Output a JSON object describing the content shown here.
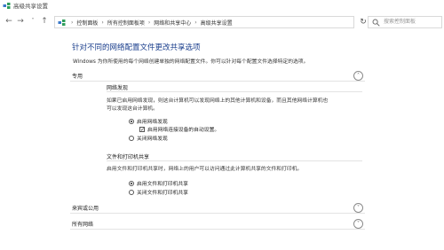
{
  "window": {
    "title": "高级共享设置"
  },
  "address": {
    "breadcrumbs": [
      "控制面板",
      "所有控制面板项",
      "网络和共享中心",
      "高级共享设置"
    ]
  },
  "search": {
    "placeholder": "搜索控制面板"
  },
  "main": {
    "heading": "针对不同的网络配置文件更改共享选项",
    "description": "Windows 为你所使用的每个网络创建单独的网络配置文件。你可以针对每个配置文件选择特定的选项。",
    "profiles": {
      "private": {
        "label": "专用",
        "network_discovery": {
          "title": "网络发现",
          "text_line1": "如果已启用网络发现，则这台计算机可以发现网络上的其他计算机和设备，而且其他网络计算机也",
          "text_line2": "可以发现这台计算机。",
          "option_on": "启用网络发现",
          "option_auto": "启用网络连接设备的自动设置。",
          "option_off": "关闭网络发现",
          "selected": "on",
          "auto_checked": true
        },
        "file_printer_sharing": {
          "title": "文件和打印机共享",
          "text": "启用文件和打印机共享时，网络上的用户可以访问通过此计算机共享的文件和打印机。",
          "option_on": "启用文件和打印机共享",
          "option_off": "关闭文件和打印机共享",
          "selected": "on"
        }
      },
      "guest_public": {
        "label": "来宾或公用"
      },
      "all_networks": {
        "label": "所有网络"
      }
    }
  }
}
